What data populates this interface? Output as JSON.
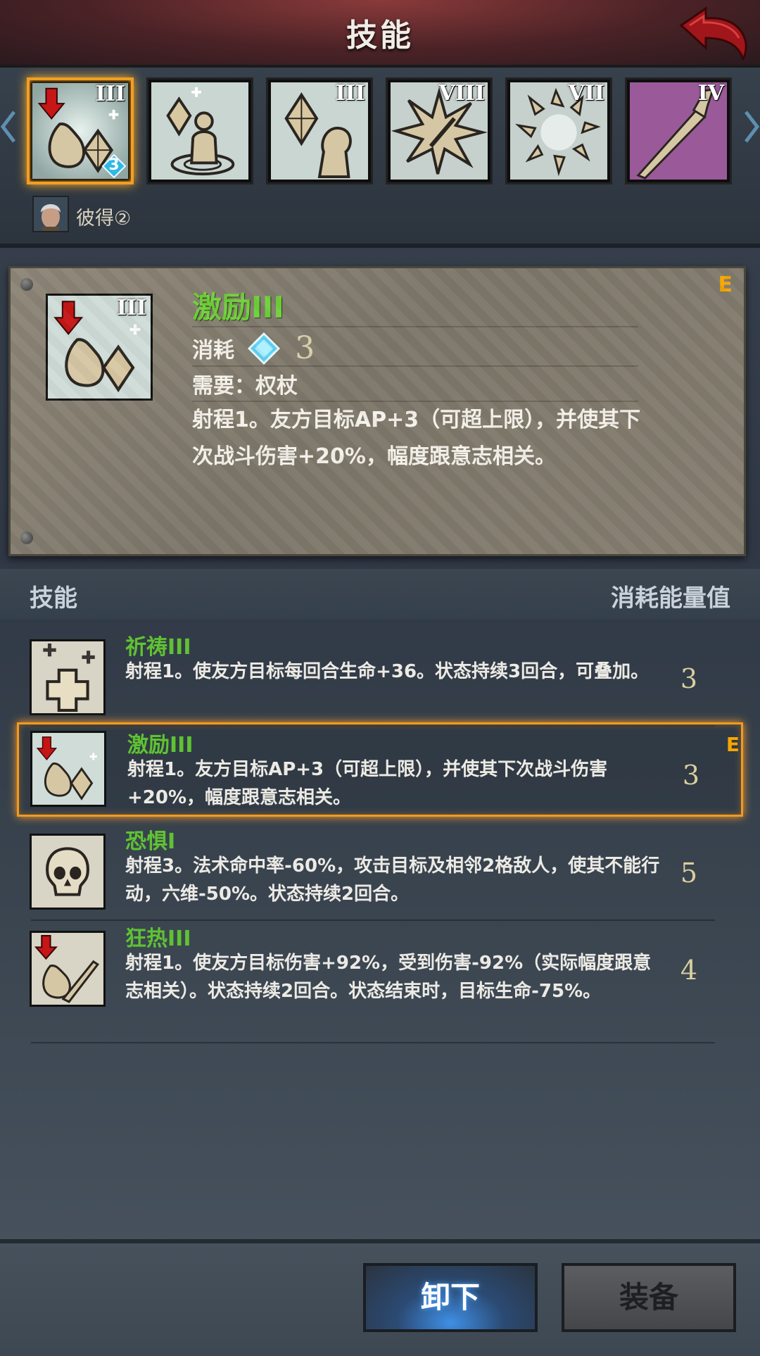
{
  "header": {
    "title": "技能"
  },
  "strip": {
    "slots": [
      {
        "roman": "III",
        "badge": "3",
        "selected": true
      },
      {
        "roman": "",
        "selected": false
      },
      {
        "roman": "III",
        "selected": false
      },
      {
        "roman": "VIII",
        "selected": false
      },
      {
        "roman": "VII",
        "selected": false
      },
      {
        "roman": "IV",
        "selected": false
      }
    ],
    "character": {
      "name": "彼得②"
    }
  },
  "detail": {
    "title": "激励III",
    "tag": "E",
    "cost_label": "消耗",
    "cost_value": "3",
    "requirement": "需要：权杖",
    "description": "射程1。友方目标AP+3（可超上限），并使其下次战斗伤害+20%，幅度跟意志相关。"
  },
  "list_header": {
    "left": "技能",
    "right": "消耗能量值"
  },
  "skills": [
    {
      "name": "祈祷III",
      "desc": "射程1。使友方目标每回合生命+36。状态持续3回合，可叠加。",
      "cost": "3",
      "tag": ""
    },
    {
      "name": "激励III",
      "desc": "射程1。友方目标AP+3（可超上限），并使其下次战斗伤害+20%，幅度跟意志相关。",
      "cost": "3",
      "tag": "E"
    },
    {
      "name": "恐惧I",
      "desc": "射程3。法术命中率-60%，攻击目标及相邻2格敌人，使其不能行动，六维-50%。状态持续2回合。",
      "cost": "5",
      "tag": ""
    },
    {
      "name": "狂热III",
      "desc": "射程1。使友方目标伤害+92%，受到伤害-92%（实际幅度跟意志相关）。状态持续2回合。状态结束时，目标生命-75%。",
      "cost": "4",
      "tag": ""
    }
  ],
  "buttons": {
    "unequip": "卸下",
    "equip": "装备"
  },
  "colors": {
    "accent_orange": "#f29a20",
    "skill_green": "#5fc233",
    "panel": "#857e70"
  }
}
